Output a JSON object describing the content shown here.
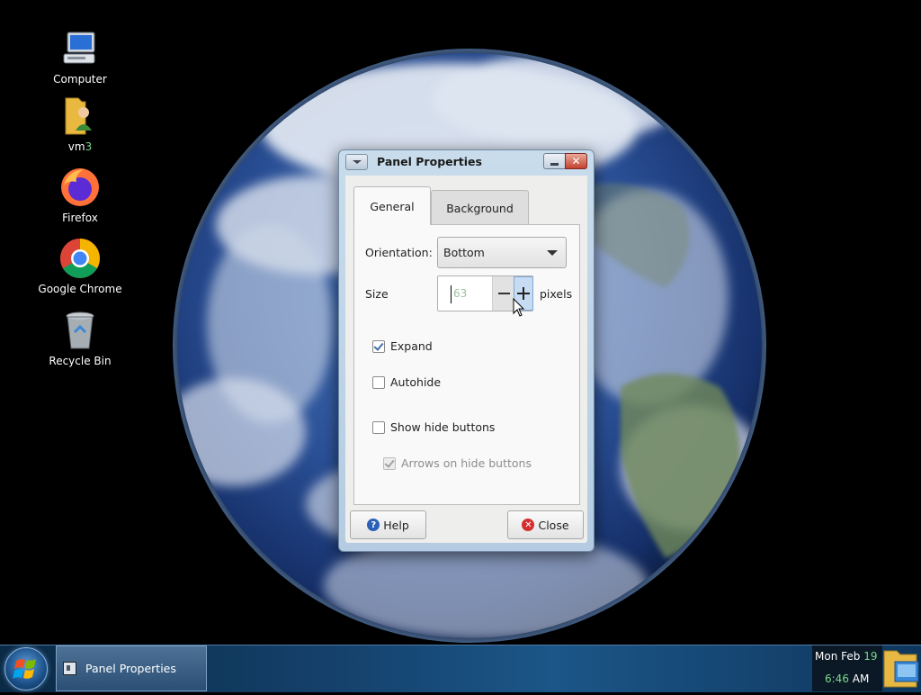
{
  "desktop": {
    "icons": [
      {
        "label": "Computer",
        "icon": "computer-icon"
      },
      {
        "label_main": "vm",
        "label_accent": "3",
        "icon": "user-folder-icon"
      },
      {
        "label": "Firefox",
        "icon": "firefox-icon"
      },
      {
        "label": "Google Chrome",
        "icon": "chrome-icon"
      },
      {
        "label": "Recycle Bin",
        "icon": "recycle-bin-icon"
      }
    ]
  },
  "dialog": {
    "title": "Panel Properties",
    "tabs": [
      {
        "label": "General",
        "active": true
      },
      {
        "label": "Background",
        "active": false
      }
    ],
    "orientation": {
      "label": "Orientation:",
      "value": "Bottom"
    },
    "size": {
      "label": "Size",
      "value": "63",
      "unit": "pixels"
    },
    "checkboxes": [
      {
        "label": "Expand",
        "checked": true,
        "enabled": true
      },
      {
        "label": "Autohide",
        "checked": false,
        "enabled": true
      },
      {
        "label": "Show hide buttons",
        "checked": false,
        "enabled": true
      },
      {
        "label": "Arrows on hide buttons",
        "checked": true,
        "enabled": false
      }
    ],
    "buttons": {
      "help": "Help",
      "close": "Close"
    }
  },
  "taskbar": {
    "tasks": [
      {
        "label": "Panel Properties",
        "icon": "panel-app-icon"
      }
    ],
    "clock": {
      "date_main": "Mon Feb ",
      "date_day": "19",
      "time_main": "6:46",
      "time_suffix": " AM"
    }
  },
  "colors": {
    "taskbar": "#14406a",
    "dialog_frame": "#c9dcec",
    "accent_green": "#7bd88d",
    "close_red": "#c4412d"
  }
}
